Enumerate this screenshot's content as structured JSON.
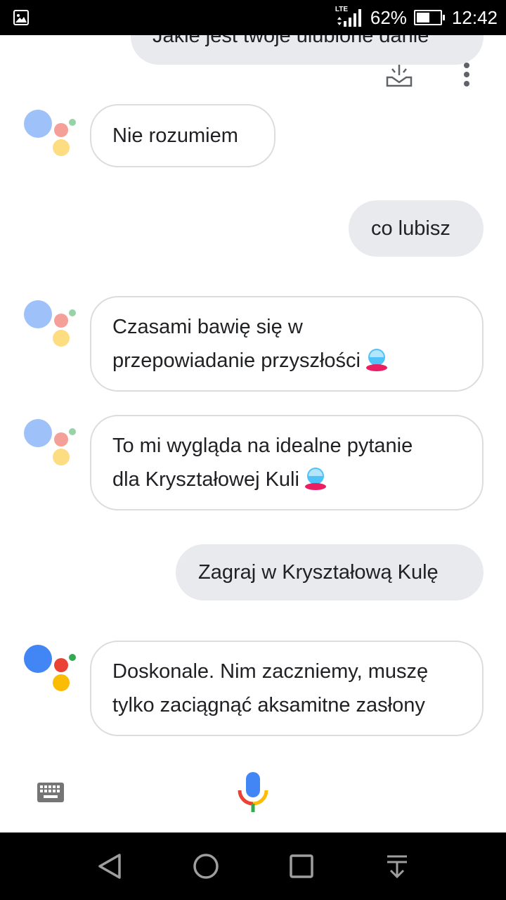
{
  "status_bar": {
    "network": "LTE",
    "battery_percent": "62%",
    "battery_level": 0.62,
    "time": "12:42"
  },
  "conversation": {
    "top_partial_user": "Jakie jest twoje ulubione danie",
    "messages": [
      {
        "from": "assistant",
        "text": "Nie rozumiem"
      },
      {
        "from": "user",
        "text": "co lubisz"
      },
      {
        "from": "assistant",
        "line1": "Czasami bawię się w",
        "line2": "przepowiadanie przyszłości",
        "icon": "crystal-ball-icon"
      },
      {
        "from": "assistant",
        "line1": "To mi wygląda na idealne pytanie",
        "line2": "dla Kryształowej Kuli",
        "icon": "crystal-ball-icon"
      },
      {
        "from": "user",
        "text": "Zagraj w Kryształową Kulę"
      },
      {
        "from": "assistant",
        "line1": "Doskonale. Nim zaczniemy, muszę",
        "line2": "tylko zaciągnąć aksamitne zasłony"
      }
    ]
  },
  "colors": {
    "blue": "#4285f4",
    "red": "#ea4335",
    "yellow": "#fbbc05",
    "green": "#34a853",
    "user_bubble": "#e8eaed",
    "bot_border": "#dadce0"
  },
  "icons": {
    "status_left": "image-icon",
    "share": "share-icon",
    "more": "more-vert-icon",
    "keyboard": "keyboard-icon",
    "mic": "mic-icon",
    "back": "back-icon",
    "home": "home-icon",
    "recents": "recents-icon",
    "notifications": "notification-pull-icon"
  }
}
